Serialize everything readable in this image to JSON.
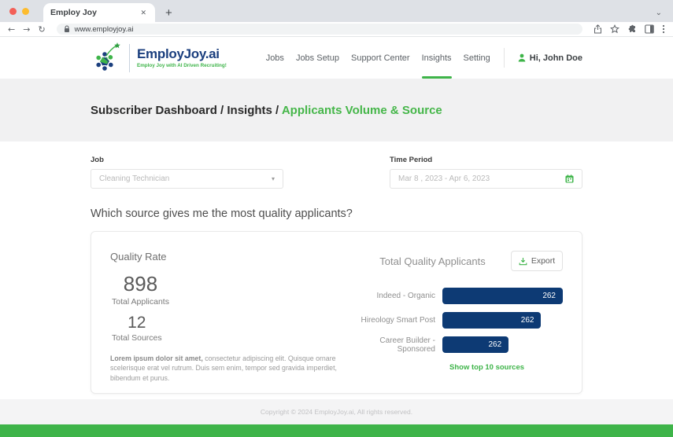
{
  "browser": {
    "tab_title": "Employ Joy",
    "url": "www.employjoy.ai"
  },
  "header": {
    "logo_text": "EmployJoy.ai",
    "logo_tagline": "Employ Joy with AI Driven Recruiting!",
    "nav": [
      "Jobs",
      "Jobs Setup",
      "Support Center",
      "Insights",
      "Setting"
    ],
    "user_greeting": "Hi, John Doe"
  },
  "breadcrumb": {
    "path": "Subscriber Dashboard / Insights / ",
    "current": "Applicants Volume & Source"
  },
  "filters": {
    "job_label": "Job",
    "job_value": "Cleaning Technician",
    "period_label": "Time Period",
    "period_value": "Mar 8 , 2023 - Apr 6, 2023"
  },
  "question": "Which source gives me the most quality applicants?",
  "card": {
    "quality_rate_title": "Quality Rate",
    "total_applicants_value": "898",
    "total_applicants_label": "Total Applicants",
    "total_sources_value": "12",
    "total_sources_label": "Total Sources",
    "description_bold": "Lorem ipsum dolor sit amet,",
    "description_rest": " consectetur adipiscing elit. Quisque ornare scelerisque erat vel rutrum. Duis sem enim, tempor sed gravida imperdiet, bibendum et purus.",
    "export_label": "Export",
    "show_link": "Show top 10 sources"
  },
  "chart_data": {
    "type": "bar",
    "orientation": "horizontal",
    "title": "Total Quality Applicants",
    "categories": [
      "Indeed - Organic",
      "Hireology Smart Post",
      "Career Builder - Sponsored"
    ],
    "values": [
      262,
      262,
      262
    ],
    "bar_widths_pct": [
      100,
      82,
      55
    ],
    "bar_color": "#0d3a74",
    "legend": "none",
    "grid": false
  },
  "footer": {
    "copyright": "Copyright © 2024 EmployJoy.ai, All rights reserved."
  },
  "colors": {
    "accent_green": "#3eb449",
    "brand_navy": "#1b3f7e",
    "bar_navy": "#0d3a74"
  }
}
